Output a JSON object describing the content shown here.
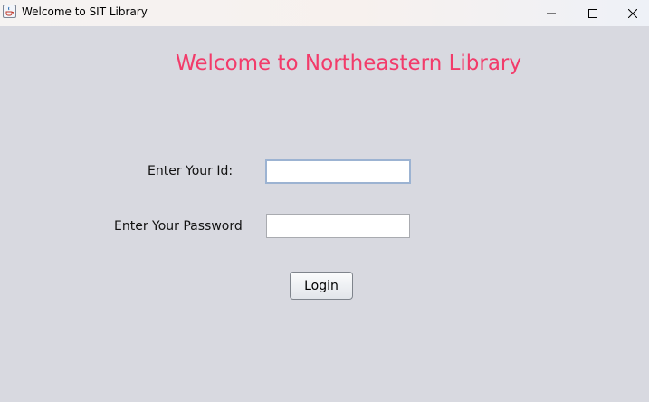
{
  "window": {
    "title": "Welcome to SIT Library",
    "icon": "java-app-icon",
    "controls": [
      "minimize-icon",
      "maximize-icon",
      "close-icon"
    ]
  },
  "main": {
    "heading": "Welcome to Northeastern Library",
    "id_label": "Enter Your Id:",
    "id_value": "",
    "password_label": "Enter Your Password",
    "password_value": "",
    "login_label": "Login"
  },
  "colors": {
    "heading": "#f23b6a",
    "background": "#d8d9e0",
    "focus_border": "#9cb3d2"
  }
}
